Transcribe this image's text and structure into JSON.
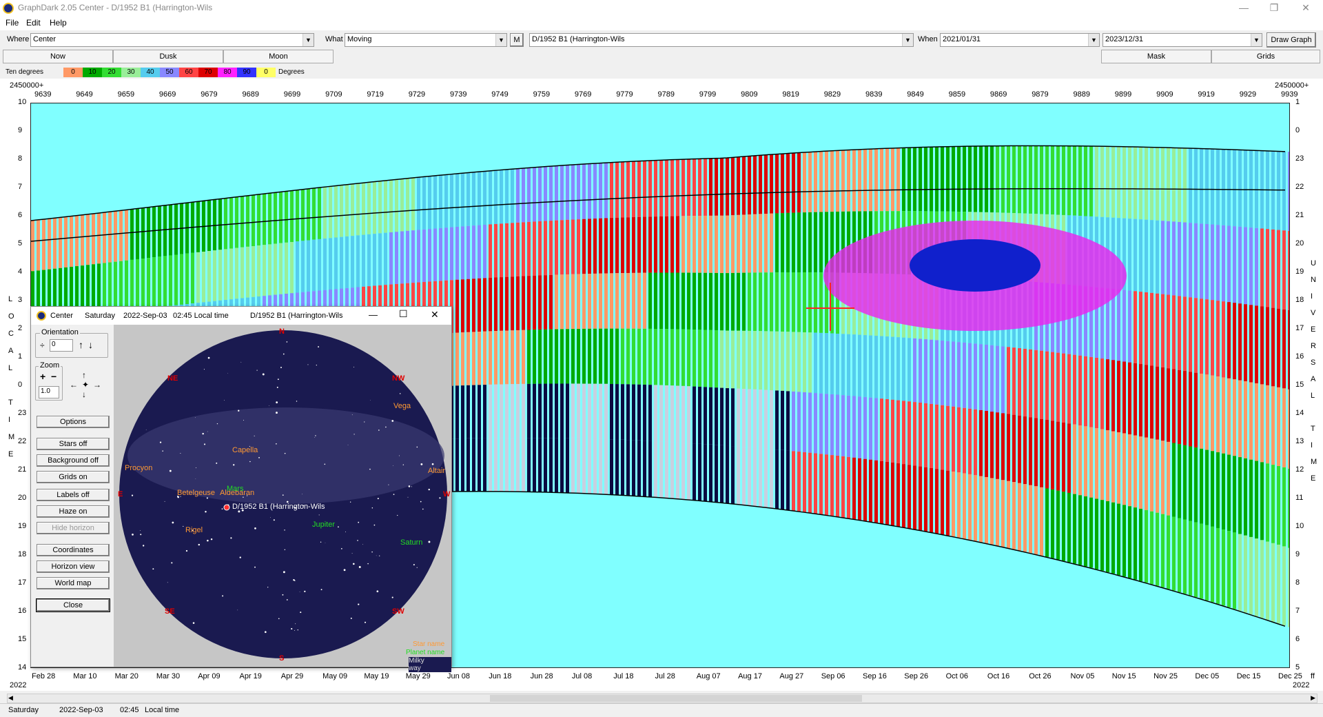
{
  "window": {
    "title": "GraphDark 2.05  Center  -  D/1952 B1 (Harrington-Wils",
    "minimize": "—",
    "maximize": "❐",
    "close": "✕"
  },
  "menu": [
    "File",
    "Edit",
    "Help"
  ],
  "toolbar": {
    "where_label": "Where",
    "where_value": "Center",
    "what_label": "What",
    "what_value": "Moving",
    "m_button": "M",
    "object_value": "D/1952 B1 (Harrington-Wils",
    "when_label": "When",
    "when_start": "2021/01/31",
    "when_end": "2023/12/31",
    "draw_button": "Draw Graph"
  },
  "tabs": {
    "now": "Now",
    "dusk": "Dusk",
    "moon": "Moon",
    "mask": "Mask",
    "grids": "Grids"
  },
  "legend": {
    "left_label": "Ten degrees",
    "right_label": "Degrees",
    "items": [
      {
        "t": "0",
        "c": "#ff9966"
      },
      {
        "t": "10",
        "c": "#00aa00"
      },
      {
        "t": "20",
        "c": "#33dd33"
      },
      {
        "t": "30",
        "c": "#99ee99"
      },
      {
        "t": "40",
        "c": "#55ccee"
      },
      {
        "t": "50",
        "c": "#8888ff"
      },
      {
        "t": "60",
        "c": "#ff4444"
      },
      {
        "t": "70",
        "c": "#dd0000"
      },
      {
        "t": "80",
        "c": "#ff22ff"
      },
      {
        "t": "90",
        "c": "#3333ff"
      },
      {
        "t": "0",
        "c": "#ffff66"
      }
    ]
  },
  "graph": {
    "top_left_label": "2450000+",
    "top_right_label": "2450000+",
    "jd_ticks": [
      "9639",
      "9649",
      "9659",
      "9669",
      "9679",
      "9689",
      "9699",
      "9709",
      "9719",
      "9729",
      "9739",
      "9749",
      "9759",
      "9769",
      "9779",
      "9789",
      "9799",
      "9809",
      "9819",
      "9829",
      "9839",
      "9849",
      "9859",
      "9869",
      "9879",
      "9889",
      "9899",
      "9909",
      "9919",
      "9929",
      "9939"
    ],
    "date_ticks": [
      "Feb 28",
      "Mar 10",
      "Mar 20",
      "Mar 30",
      "Apr 09",
      "Apr 19",
      "Apr 29",
      "May 09",
      "May 19",
      "May 29",
      "Jun 08",
      "Jun 18",
      "Jun 28",
      "Jul 08",
      "Jul 18",
      "Jul 28",
      "Aug 07",
      "Aug 17",
      "Aug 27",
      "Sep 06",
      "Sep 16",
      "Sep 26",
      "Oct 06",
      "Oct 16",
      "Oct 26",
      "Nov 05",
      "Nov 15",
      "Nov 25",
      "Dec 05",
      "Dec 15",
      "Dec 25"
    ],
    "year_left": "2022",
    "year_right": "2022",
    "corner_right": "ff",
    "left_ticks": [
      "10",
      "9",
      "8",
      "7",
      "6",
      "5",
      "4",
      "3",
      "2",
      "1",
      "0",
      "23",
      "22",
      "21",
      "20",
      "19",
      "18",
      "17",
      "16",
      "15",
      "14"
    ],
    "right_ticks": [
      "1",
      "0",
      "23",
      "22",
      "21",
      "20",
      "19",
      "18",
      "17",
      "16",
      "15",
      "14",
      "13",
      "12",
      "11",
      "10",
      "9",
      "8",
      "7",
      "6",
      "5"
    ],
    "left_axis_text": [
      "L",
      "O",
      "C",
      "A",
      "L",
      "",
      "T",
      "I",
      "M",
      "E"
    ],
    "right_axis_text": [
      "U",
      "N",
      "I",
      "V",
      "E",
      "R",
      "S",
      "A",
      "L",
      "",
      "T",
      "I",
      "M",
      "E"
    ]
  },
  "popup": {
    "title_obj": "Center",
    "day": "Saturday",
    "date": "2022-Sep-03",
    "time": "02:45 Local time",
    "object": "D/1952 B1 (Harrington-Wils",
    "orientation_label": "Orientation",
    "orientation_value": "0",
    "zoom_label": "Zoom",
    "zoom_value": "1.0",
    "buttons": [
      "Options",
      "Stars off",
      "Background off",
      "Grids on",
      "Labels off",
      "Haze on",
      "Hide horizon",
      "Coordinates",
      "Horizon view",
      "World map",
      "Close"
    ],
    "directions": {
      "n": "N",
      "ne": "NE",
      "nw": "NW",
      "e": "E",
      "w": "W",
      "se": "SE",
      "sw": "SW",
      "s": "S"
    },
    "stars": [
      "Vega",
      "Capella",
      "Procyon",
      "Altair",
      "Betelgeuse",
      "Aldebaran",
      "Rigel"
    ],
    "planets": [
      "Mars",
      "Jupiter",
      "Saturn"
    ],
    "target": "D/1952 B1 (Harrington-Wils",
    "legend_star": "Star name",
    "legend_planet": "Planet name",
    "legend_milky": "Milky way"
  },
  "status": {
    "day": "Saturday",
    "date": "2022-Sep-03",
    "time": "02:45",
    "time_label": "Local time"
  }
}
